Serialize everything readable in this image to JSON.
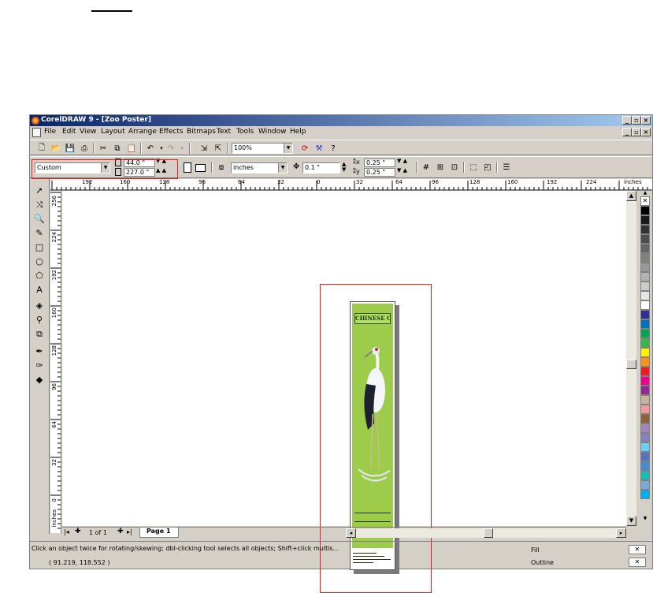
{
  "window": {
    "title": "CorelDRAW 9 - [Zoo Poster]",
    "caption_buttons": [
      "_",
      "▫",
      "×"
    ]
  },
  "menu": [
    "File",
    "Edit",
    "View",
    "Layout",
    "Arrange",
    "Effects",
    "Bitmaps",
    "Text",
    "Tools",
    "Window",
    "Help"
  ],
  "toolbar": {
    "zoom": "100%"
  },
  "property_bar": {
    "paper_type": "Custom",
    "width": "44.0 \"",
    "height": "227.0 \"",
    "units": "inches",
    "nudge": "0.1 \"",
    "duplicate_x": "0.25 \"",
    "duplicate_y": "0.25 \""
  },
  "ruler": {
    "top_labels": [
      "192",
      "160",
      "128",
      "96",
      "64",
      "32",
      "0",
      "32",
      "64",
      "96",
      "128",
      "160",
      "192",
      "224"
    ],
    "left_labels": [
      "256",
      "224",
      "192",
      "160",
      "128",
      "96",
      "64",
      "32",
      "0"
    ],
    "unit": "inches"
  },
  "page_nav": {
    "counter": "1 of 1",
    "tab": "Page 1"
  },
  "status": {
    "hint": "Click an object twice for rotating/skewing; dbl-clicking tool selects all objects; Shift+click multis...",
    "coords": "( 91.219, 118.552 )",
    "fill_label": "Fill",
    "outline_label": "Outline"
  },
  "poster": {
    "title": "CHINESE CRANES"
  },
  "colors": {
    "palette": [
      "#ffffff",
      "#000000",
      "#1a1a1a",
      "#333333",
      "#4d4d4d",
      "#666666",
      "#808080",
      "#999999",
      "#b3b3b3",
      "#cccccc",
      "#e6e6e6",
      "#ffffff",
      "#2e3192",
      "#0072bc",
      "#00a651",
      "#39b54a",
      "#fff200",
      "#f7941d",
      "#ed1c24",
      "#ec008c",
      "#92278f",
      "#c2b59b",
      "#f5989d",
      "#8c6239",
      "#a186be",
      "#8781bd",
      "#6dcff6",
      "#5674b9",
      "#448ccb",
      "#1cbbb4",
      "#7da7d9",
      "#00aeef"
    ]
  }
}
